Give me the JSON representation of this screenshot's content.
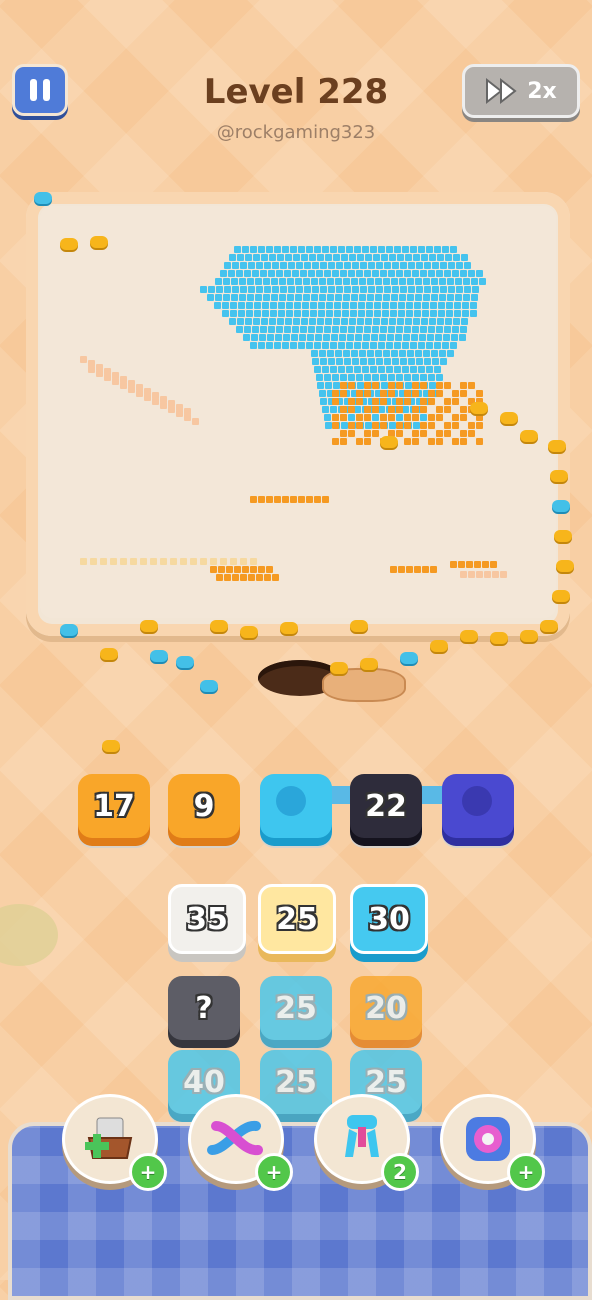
{
  "header": {
    "level_title": "Level 228",
    "watermark": "@rockgaming323",
    "speed_label": "2x"
  },
  "queue_tiles": [
    {
      "count": "17",
      "color": "#f9a629"
    },
    {
      "count": "9",
      "color": "#f9a629"
    },
    {
      "count": "",
      "color": "#3ec6ef"
    },
    {
      "count": "22",
      "color": "#2e2c3b"
    },
    {
      "count": "",
      "color": "#4a49d0"
    }
  ],
  "stack_tiles": [
    {
      "count": "35",
      "color": "#f2f0ec"
    },
    {
      "count": "25",
      "color": "#ffe7a0"
    },
    {
      "count": "30",
      "color": "#45c9f0"
    },
    {
      "count": "?",
      "color": "#5d5d66"
    },
    {
      "count": "25",
      "color": "#45c9f0"
    },
    {
      "count": "20",
      "color": "#f9a629"
    },
    {
      "count": "40",
      "color": "#45c9f0"
    },
    {
      "count": "25",
      "color": "#45c9f0"
    },
    {
      "count": "25",
      "color": "#45c9f0"
    }
  ],
  "boosters": [
    {
      "icon": "add-box-icon",
      "badge": "+"
    },
    {
      "icon": "shuffle-arrows-icon",
      "badge": "+"
    },
    {
      "icon": "magnet-claw-icon",
      "badge": "2"
    },
    {
      "icon": "donut-ring-icon",
      "badge": "+"
    }
  ],
  "colors": {
    "background": "#f7c99a",
    "board": "#f3e7d8",
    "pixel_blue": "#45c3ee",
    "pixel_orange": "#f59a22",
    "pixel_peach": "#f7c7a1",
    "ant": "#f7b51b"
  }
}
